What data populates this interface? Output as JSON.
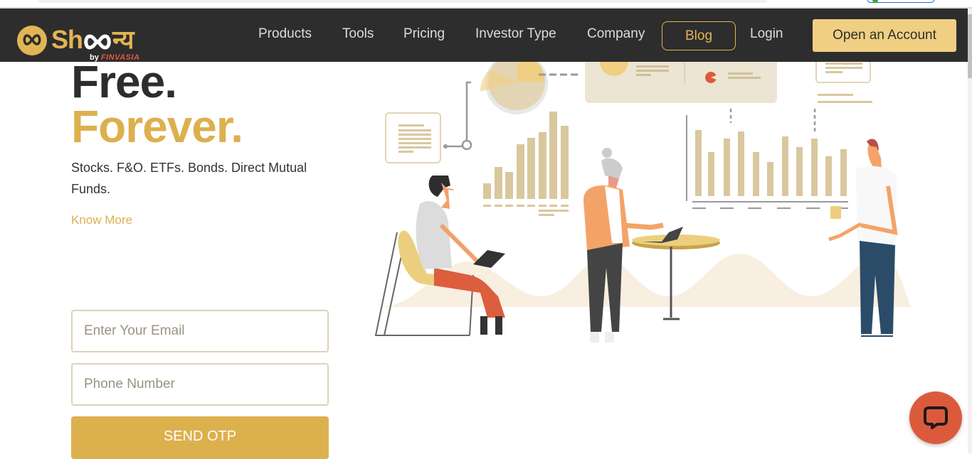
{
  "brand": {
    "name_latin": "Sh",
    "name_devanagari": "न्य",
    "byline_prefix": "by",
    "byline_brand": "FINVASIA"
  },
  "nav": {
    "items": [
      {
        "label": "Products"
      },
      {
        "label": "Tools"
      },
      {
        "label": "Pricing"
      },
      {
        "label": "Investor Type"
      },
      {
        "label": "Company"
      }
    ],
    "blog_label": "Blog",
    "login_label": "Login",
    "open_account_label": "Open an Account"
  },
  "hero": {
    "headline_line1": "Free.",
    "headline_line2": "Forever.",
    "subtitle": "Stocks. F&O. ETFs. Bonds. Direct Mutual Funds.",
    "know_more_label": "Know More"
  },
  "form": {
    "email_placeholder": "Enter Your Email",
    "email_value": "",
    "phone_placeholder": "Phone Number",
    "phone_value": "",
    "submit_label": "SEND OTP"
  },
  "colors": {
    "navbar_bg": "#2d2d2d",
    "accent_gold": "#ddb04e",
    "cta_gold": "#f0cf82",
    "chat_red": "#dc5a3c"
  },
  "chat": {
    "icon": "chat-bubble-icon"
  }
}
